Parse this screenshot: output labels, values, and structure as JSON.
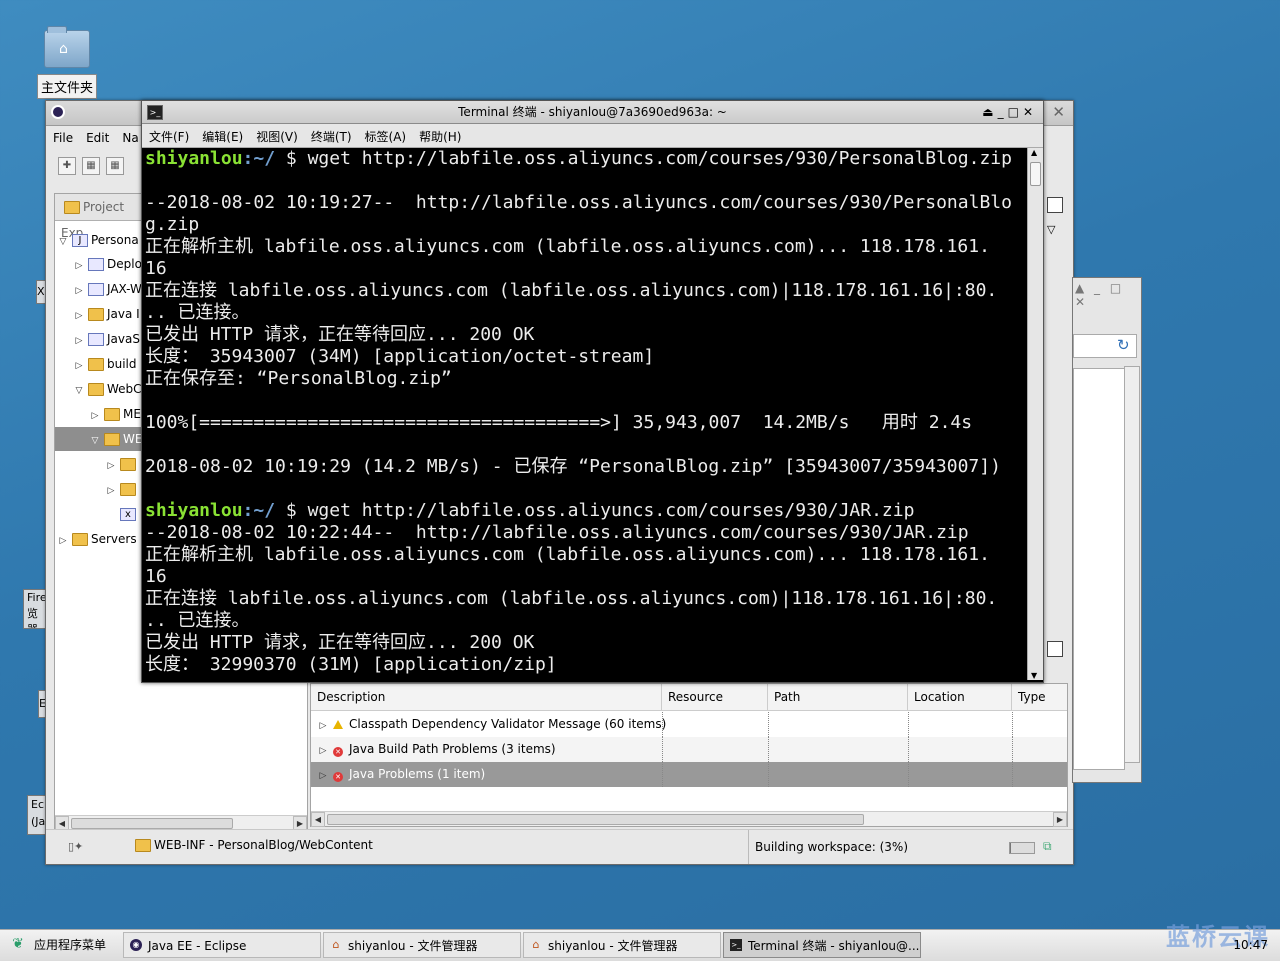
{
  "desktop": {
    "home_icon_label": "主文件夹",
    "peek_labels": [
      "X",
      "Fire",
      "览器",
      "E",
      "Ec",
      "(Ja"
    ]
  },
  "eclipse": {
    "menu": [
      "File",
      "Edit",
      "Na"
    ],
    "project_explorer_tab": "Project Exp",
    "tree": [
      {
        "label": "Persona",
        "expanded": true
      },
      {
        "label": "Deplo",
        "expanded": false
      },
      {
        "label": "JAX-W",
        "expanded": false
      },
      {
        "label": "Java I",
        "expanded": false
      },
      {
        "label": "JavaS",
        "expanded": false
      },
      {
        "label": "build",
        "expanded": false
      },
      {
        "label": "WebC",
        "expanded": true
      },
      {
        "label": "ME",
        "expanded": false
      },
      {
        "label": "WE",
        "expanded": true
      },
      {
        "label": "",
        "expanded": false
      },
      {
        "label": "",
        "expanded": false
      },
      {
        "label": "",
        "expanded": false
      },
      {
        "label": "Servers",
        "expanded": false
      }
    ],
    "problems": {
      "columns": [
        "Description",
        "Resource",
        "Path",
        "Location",
        "Type"
      ],
      "rows": [
        {
          "label": "Classpath Dependency Validator Message (60 items)",
          "severity": "warning"
        },
        {
          "label": "Java Build Path Problems (3 items)",
          "severity": "error"
        },
        {
          "label": "Java Problems (1 item)",
          "severity": "error"
        }
      ]
    },
    "status": {
      "path": "WEB-INF - PersonalBlog/WebContent",
      "building": "Building workspace: (3%)",
      "progress_fraction": 0.03
    }
  },
  "terminal": {
    "title": "Terminal 终端 - shiyanlou@7a3690ed963a: ~",
    "menu": [
      "文件(F)",
      "编辑(E)",
      "视图(V)",
      "终端(T)",
      "标签(A)",
      "帮助(H)"
    ],
    "prompt_user": "shiyanlou",
    "prompt_path": ":~/",
    "commands": [
      " $ wget http://labfile.oss.aliyuncs.com/courses/930/PersonalBlog.zip",
      " $ wget http://labfile.oss.aliyuncs.com/courses/930/JAR.zip"
    ],
    "output1": [
      "",
      "--2018-08-02 10:19:27--  http://labfile.oss.aliyuncs.com/courses/930/PersonalBlo",
      "g.zip",
      "正在解析主机 labfile.oss.aliyuncs.com (labfile.oss.aliyuncs.com)... 118.178.161.",
      "16",
      "正在连接 labfile.oss.aliyuncs.com (labfile.oss.aliyuncs.com)|118.178.161.16|:80.",
      ".. 已连接。",
      "已发出 HTTP 请求，正在等待回应... 200 OK",
      "长度： 35943007 (34M) [application/octet-stream]",
      "正在保存至: “PersonalBlog.zip”",
      "",
      "100%[=====================================>] 35,943,007  14.2MB/s   用时 2.4s",
      "",
      "2018-08-02 10:19:29 (14.2 MB/s) - 已保存 “PersonalBlog.zip” [35943007/35943007])",
      ""
    ],
    "output2": [
      "--2018-08-02 10:22:44--  http://labfile.oss.aliyuncs.com/courses/930/JAR.zip",
      "正在解析主机 labfile.oss.aliyuncs.com (labfile.oss.aliyuncs.com)... 118.178.161.",
      "16",
      "正在连接 labfile.oss.aliyuncs.com (labfile.oss.aliyuncs.com)|118.178.161.16|:80.",
      ".. 已连接。",
      "已发出 HTTP 请求，正在等待回应... 200 OK",
      "长度： 32990370 (31M) [application/zip]"
    ]
  },
  "taskbar": {
    "start_label": "应用程序菜单",
    "tasks": [
      {
        "label": "Java EE - Eclipse",
        "icon": "eclipse-icon",
        "active": false
      },
      {
        "label": "shiyanlou - 文件管理器",
        "icon": "home-icon",
        "active": false
      },
      {
        "label": "shiyanlou - 文件管理器",
        "icon": "home-icon",
        "active": false
      },
      {
        "label": "Terminal 终端 - shiyanlou@...",
        "icon": "terminal-icon",
        "active": true
      }
    ],
    "watermark": "蓝桥云课",
    "clock": "10:47"
  }
}
